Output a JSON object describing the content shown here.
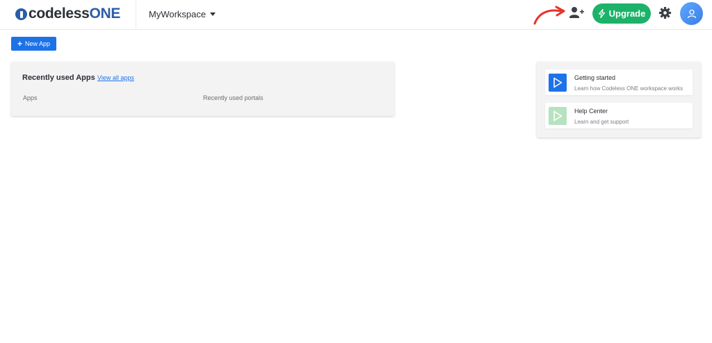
{
  "header": {
    "logo_part1": "codeless",
    "logo_part2": "ONE",
    "workspace": "MyWorkspace",
    "upgrade_label": "Upgrade"
  },
  "toolbar": {
    "new_app_icon": "+",
    "new_app_label": "New App"
  },
  "recent": {
    "title": "Recently used Apps",
    "view_all": "View all apps",
    "apps_label": "Apps",
    "portals_label": "Recently used portals"
  },
  "help": {
    "items": [
      {
        "title": "Getting started",
        "subtitle": "Learn how Codeless ONE workspace works",
        "icon": "play-icon"
      },
      {
        "title": "Help Center",
        "subtitle": "Learn and get support",
        "icon": "play-icon"
      }
    ]
  },
  "colors": {
    "accent_blue": "#1e72e8",
    "upgrade_green": "#1cb26a",
    "annotation_red": "#e8322c",
    "brand_blue": "#2b5da8"
  },
  "icons": [
    "invite-user-icon",
    "lightning-icon",
    "gear-icon",
    "user-icon",
    "caret-down-icon",
    "annotation-arrow-icon"
  ]
}
